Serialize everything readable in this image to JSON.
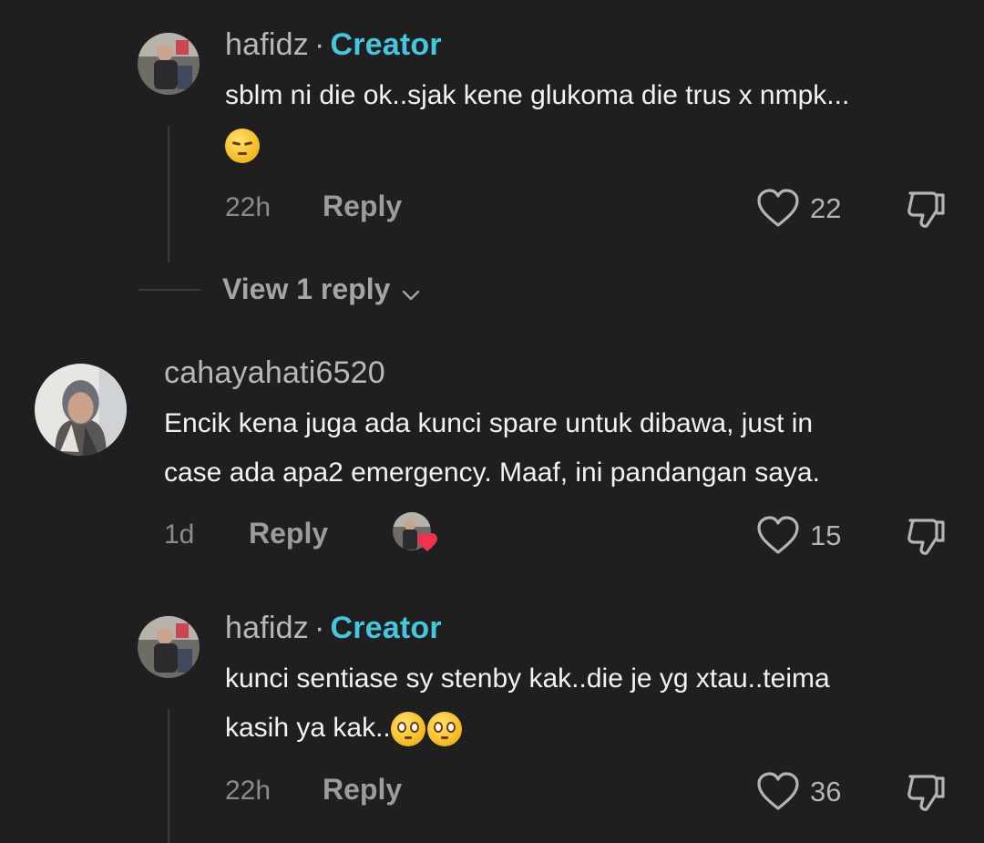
{
  "comments": [
    {
      "username": "hafidz",
      "separator": "·",
      "creator_label": "Creator",
      "text_line1": "sblm ni die ok..sjak kene glukoma die trus x nmpk...",
      "emoji": "pensive-face",
      "time": "22h",
      "reply_label": "Reply",
      "likes": "22",
      "view_replies": "View 1 reply"
    },
    {
      "username": "cahayahati6520",
      "text_line1": "Encik kena juga ada kunci spare untuk dibawa, just in",
      "text_line2": "case ada apa2 emergency. Maaf, ini pandangan saya.",
      "time": "1d",
      "reply_label": "Reply",
      "likes": "15",
      "creator_liked": true
    },
    {
      "username": "hafidz",
      "separator": "·",
      "creator_label": "Creator",
      "text_line1": "kunci sentiase sy stenby kak..die je yg xtau..teima",
      "text_line2": "kasih ya kak..",
      "emoji": "pleading-face",
      "time": "22h",
      "reply_label": "Reply",
      "likes": "36"
    }
  ],
  "colors": {
    "background": "#1f1f1f",
    "creator": "#45c6dd",
    "heart_badge": "#f0324f"
  }
}
